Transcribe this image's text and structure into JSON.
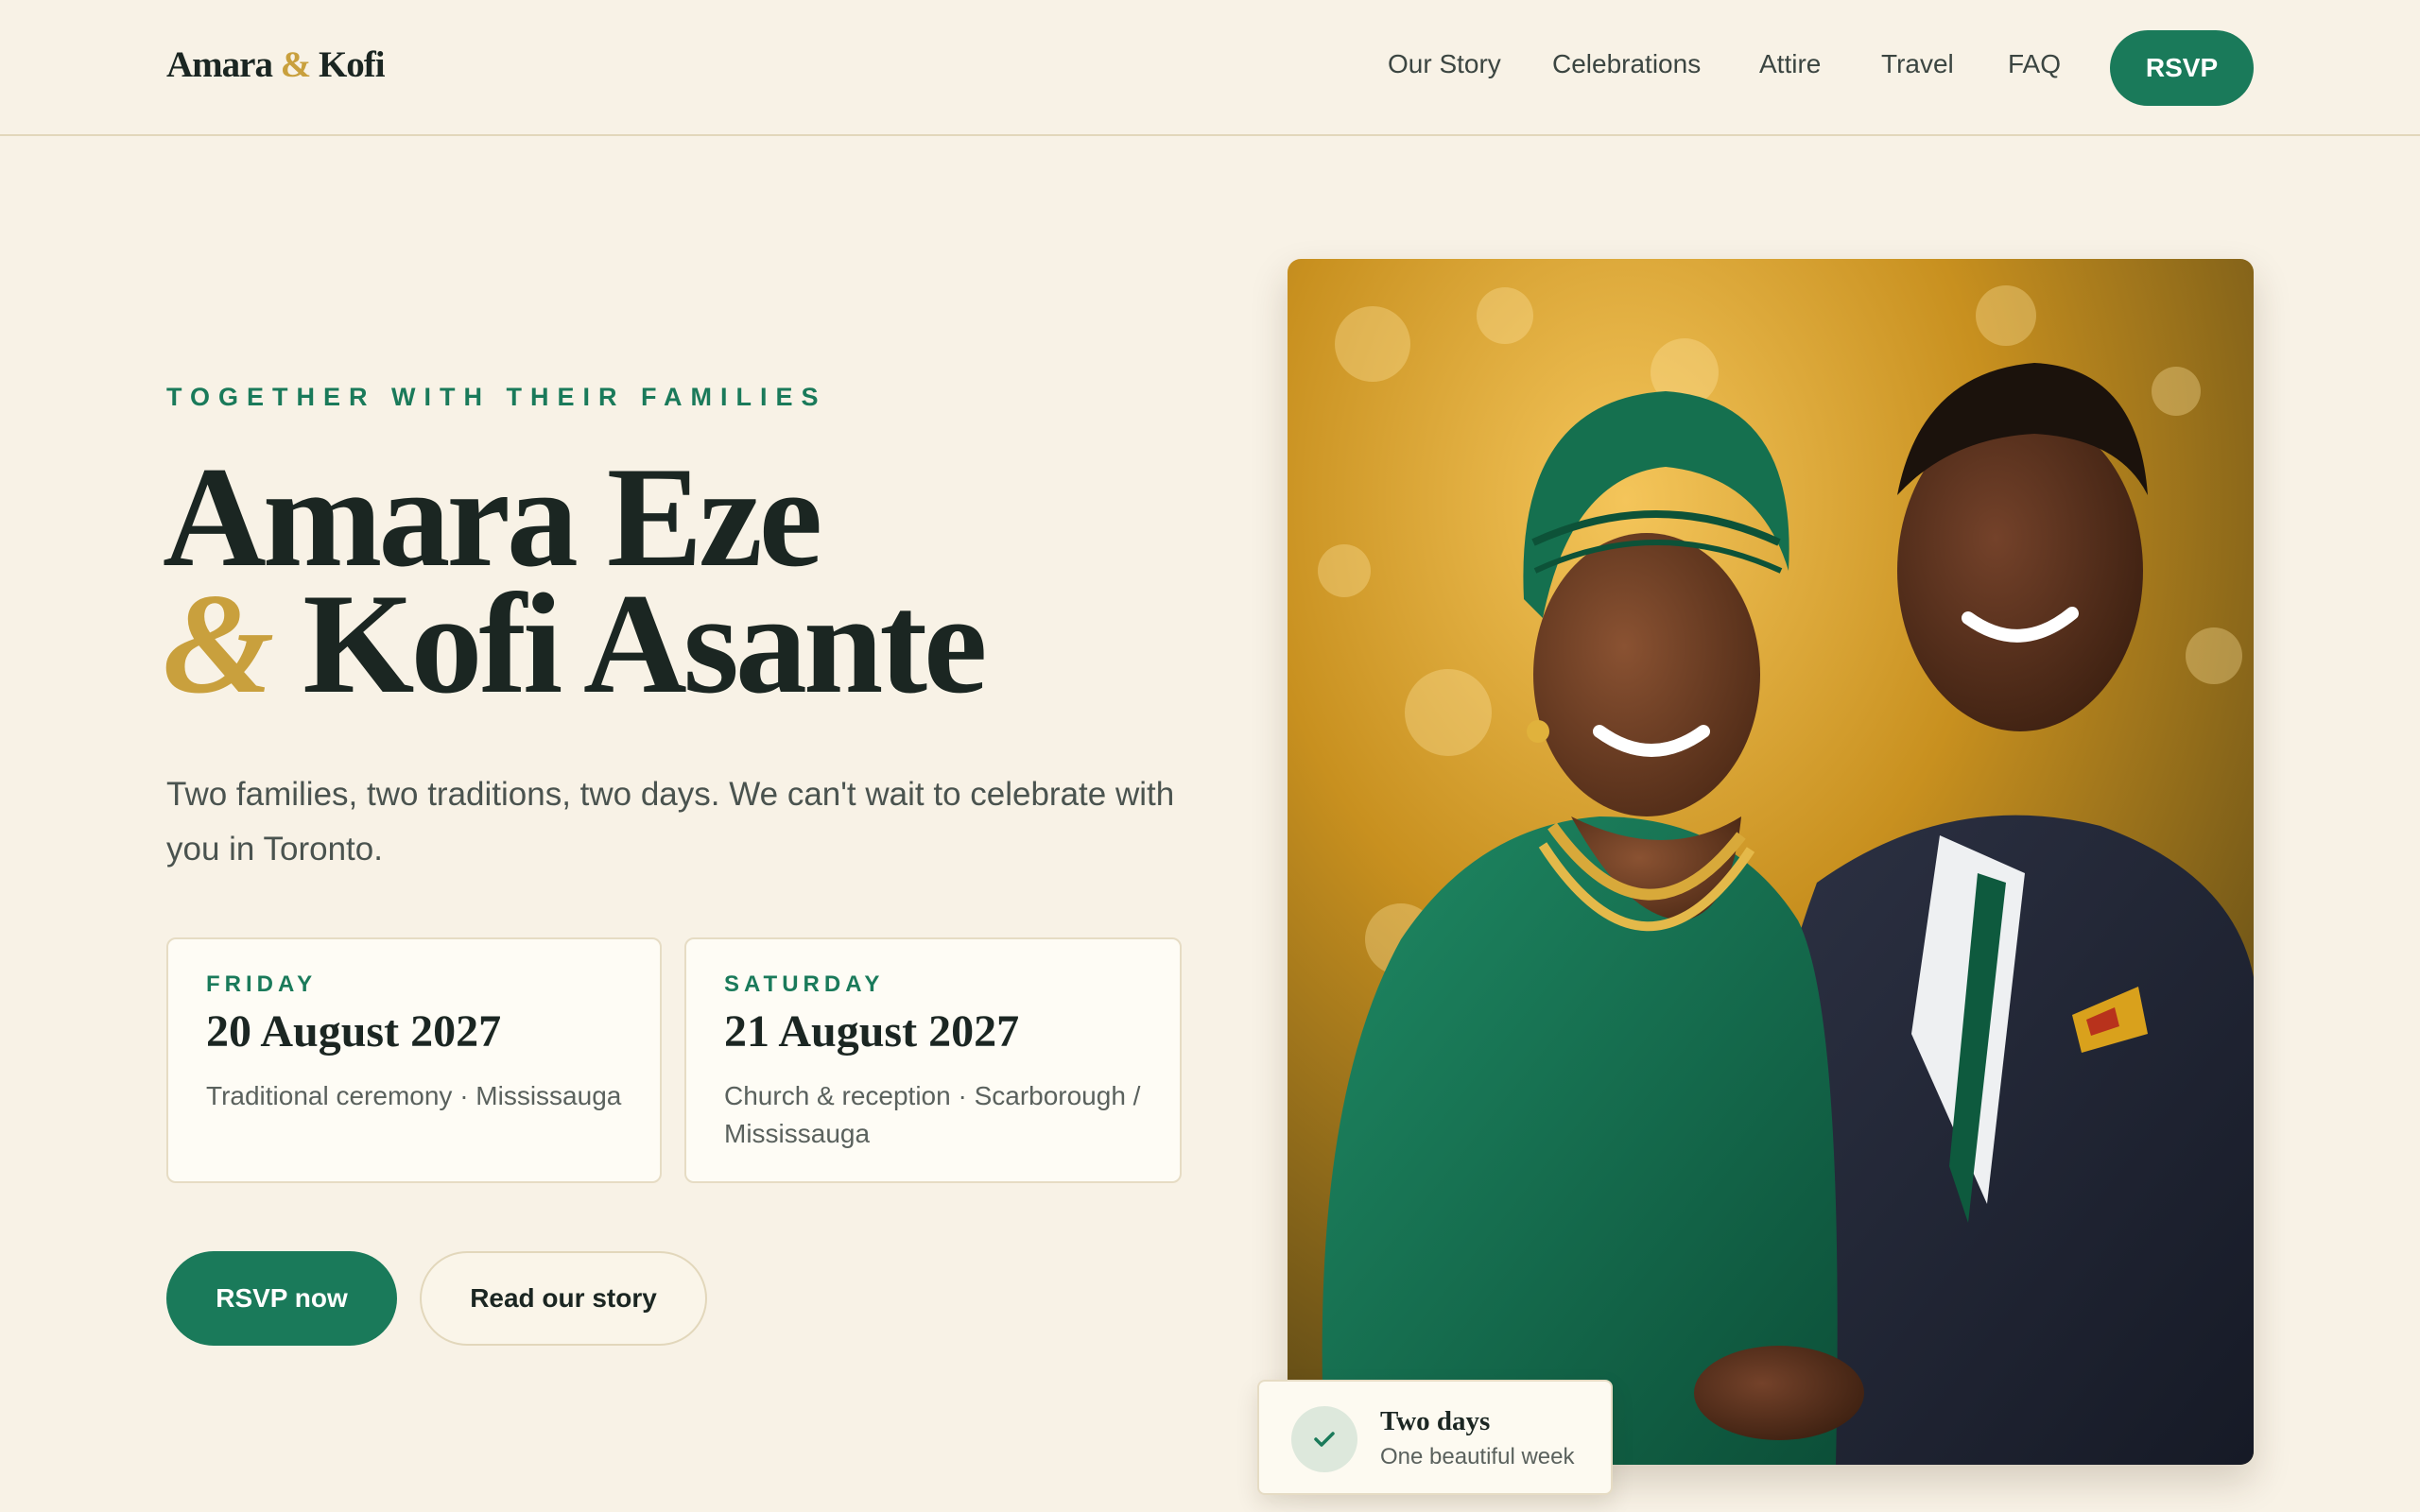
{
  "brand": {
    "name_first": "Amara",
    "amp": "&",
    "name_second": "Kofi"
  },
  "nav": {
    "links": [
      "Our Story",
      "Celebrations",
      "Attire",
      "Travel",
      "FAQ"
    ],
    "rsvp_label": "RSVP"
  },
  "hero": {
    "eyebrow": "TOGETHER WITH THEIR FAMILIES",
    "title_line1": "Amara Eze",
    "title_amp": "&",
    "title_line2": "Kofi Asante",
    "subtitle": "Two families, two traditions, two days. We can't wait to celebrate with you in Toronto."
  },
  "events": [
    {
      "day": "FRIDAY",
      "date": "20 August 2027",
      "detail": "Traditional ceremony · Mississauga"
    },
    {
      "day": "SATURDAY",
      "date": "21 August 2027",
      "detail": "Church & reception · Scarborough / Mississauga"
    }
  ],
  "actions": {
    "primary": "RSVP now",
    "secondary": "Read our story"
  },
  "badge": {
    "title": "Two days",
    "subtitle": "One beautiful week",
    "icon": "check-icon"
  },
  "colors": {
    "accent": "#1a7a5a",
    "gold": "#c9a03d",
    "background": "#f8f2e6",
    "ink": "#1b2622"
  }
}
